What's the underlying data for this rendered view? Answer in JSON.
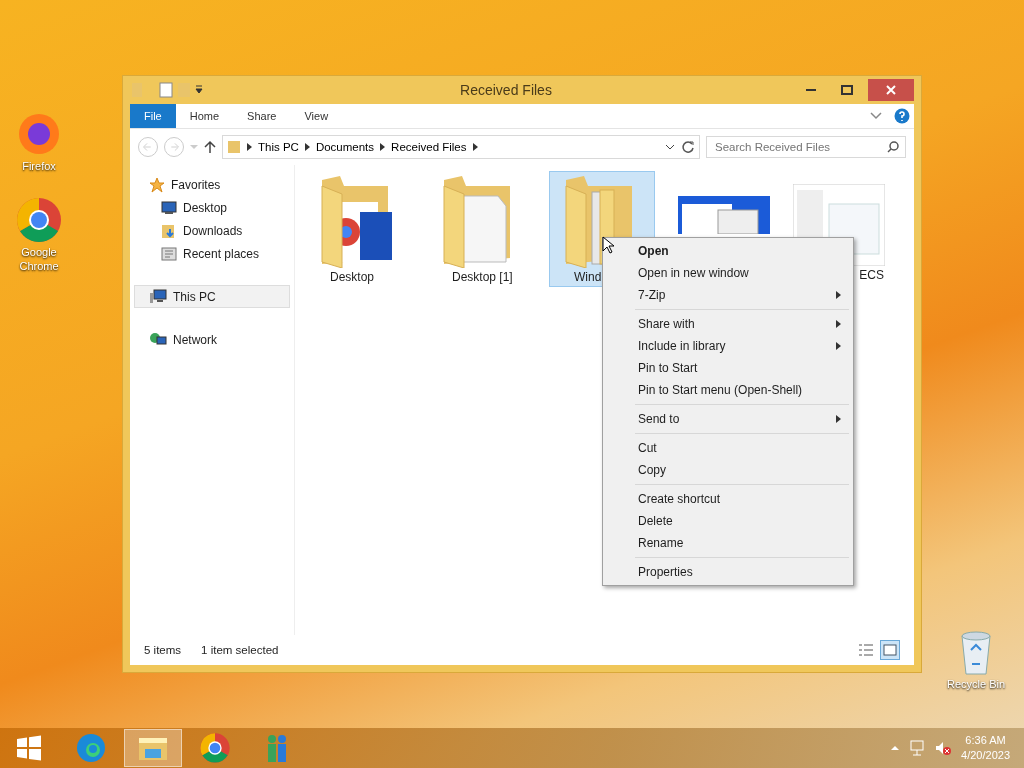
{
  "desktop_icons": [
    {
      "label": "Firefox",
      "kind": "firefox"
    },
    {
      "label": "Google Chrome",
      "kind": "chrome"
    },
    {
      "label": "Recycle Bin",
      "kind": "bin"
    }
  ],
  "window": {
    "title": "Received Files",
    "ribbon_tabs": [
      {
        "label": "File",
        "selected": true
      },
      {
        "label": "Home",
        "selected": false
      },
      {
        "label": "Share",
        "selected": false
      },
      {
        "label": "View",
        "selected": false
      }
    ],
    "address": [
      "This PC",
      "Documents",
      "Received Files"
    ],
    "search": {
      "placeholder": "Search Received Files"
    },
    "nav": [
      {
        "label": "Favorites",
        "kind": "star",
        "selected": false,
        "children": [
          {
            "label": "Desktop",
            "kind": "monitor",
            "selected": false
          },
          {
            "label": "Downloads",
            "kind": "download",
            "selected": false
          },
          {
            "label": "Recent places",
            "kind": "recent",
            "selected": false
          }
        ]
      },
      {
        "label": "This PC",
        "kind": "pc",
        "selected": true
      },
      {
        "label": "Network",
        "kind": "network",
        "selected": false
      }
    ],
    "files": [
      {
        "label": "Desktop",
        "kind": "folder",
        "selected": false
      },
      {
        "label": "Desktop [1]",
        "kind": "folder",
        "selected": false
      },
      {
        "label": "Wind",
        "kind": "folder",
        "selected": true
      },
      {
        "kind": "image",
        "selected": false
      },
      {
        "label": "ECS",
        "kind": "image",
        "selected": false
      }
    ],
    "status": {
      "count": "5 items",
      "selection": "1 item selected"
    }
  },
  "context_menu": [
    {
      "kind": "item",
      "label": "Open",
      "default": true,
      "submenu": false
    },
    {
      "kind": "item",
      "label": "Open in new window",
      "default": false,
      "submenu": false
    },
    {
      "kind": "item",
      "label": "7-Zip",
      "default": false,
      "submenu": true
    },
    {
      "kind": "separator"
    },
    {
      "kind": "item",
      "label": "Share with",
      "default": false,
      "submenu": true
    },
    {
      "kind": "item",
      "label": "Include in library",
      "default": false,
      "submenu": true
    },
    {
      "kind": "item",
      "label": "Pin to Start",
      "default": false,
      "submenu": false
    },
    {
      "kind": "item",
      "label": "Pin to Start menu (Open-Shell)",
      "default": false,
      "submenu": false
    },
    {
      "kind": "separator"
    },
    {
      "kind": "item",
      "label": "Send to",
      "default": false,
      "submenu": true
    },
    {
      "kind": "separator"
    },
    {
      "kind": "item",
      "label": "Cut",
      "default": false,
      "submenu": false
    },
    {
      "kind": "item",
      "label": "Copy",
      "default": false,
      "submenu": false
    },
    {
      "kind": "separator"
    },
    {
      "kind": "item",
      "label": "Create shortcut",
      "default": false,
      "submenu": false
    },
    {
      "kind": "item",
      "label": "Delete",
      "default": false,
      "submenu": false
    },
    {
      "kind": "item",
      "label": "Rename",
      "default": false,
      "submenu": false
    },
    {
      "kind": "separator"
    },
    {
      "kind": "item",
      "label": "Properties",
      "default": false,
      "submenu": false
    }
  ],
  "taskbar": {
    "apps": [
      {
        "kind": "edge",
        "active": false
      },
      {
        "kind": "explorer",
        "active": true
      },
      {
        "kind": "chrome",
        "active": false
      },
      {
        "kind": "people",
        "active": false
      }
    ],
    "time": "6:36 AM",
    "date": "4/20/2023"
  }
}
